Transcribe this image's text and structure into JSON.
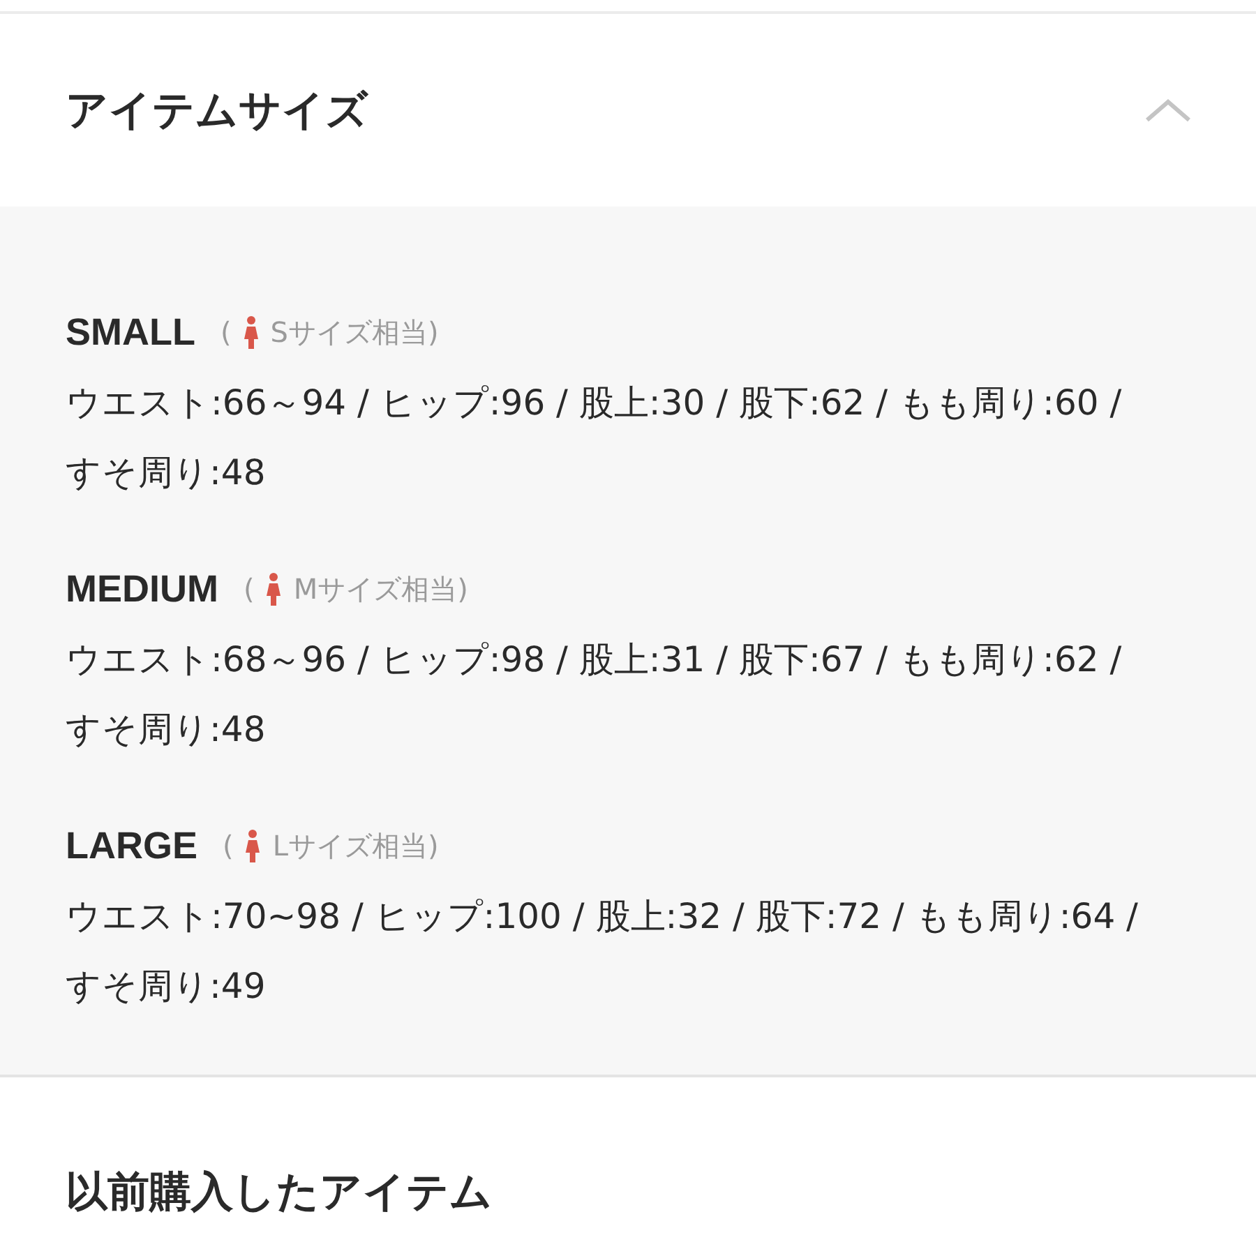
{
  "section": {
    "title": "アイテムサイズ",
    "expanded": true
  },
  "sizes": [
    {
      "name": "SMALL",
      "paren": "(",
      "note": "Sサイズ相当)",
      "detail": "ウエスト:66～94 / ヒップ:96 / 股上:30 / 股下:62 / もも周り:60 / すそ周り:48"
    },
    {
      "name": "MEDIUM",
      "paren": "(",
      "note": "Mサイズ相当)",
      "detail": "ウエスト:68～96 / ヒップ:98 / 股上:31 / 股下:67 / もも周り:62 / すそ周り:48"
    },
    {
      "name": "LARGE",
      "paren": "(",
      "note": "Lサイズ相当)",
      "detail": "ウエスト:70~98 / ヒップ:100 / 股上:32 / 股下:72 / もも周り:64 / すそ周り:49"
    }
  ],
  "next_section": {
    "title": "以前購入したアイテム"
  }
}
